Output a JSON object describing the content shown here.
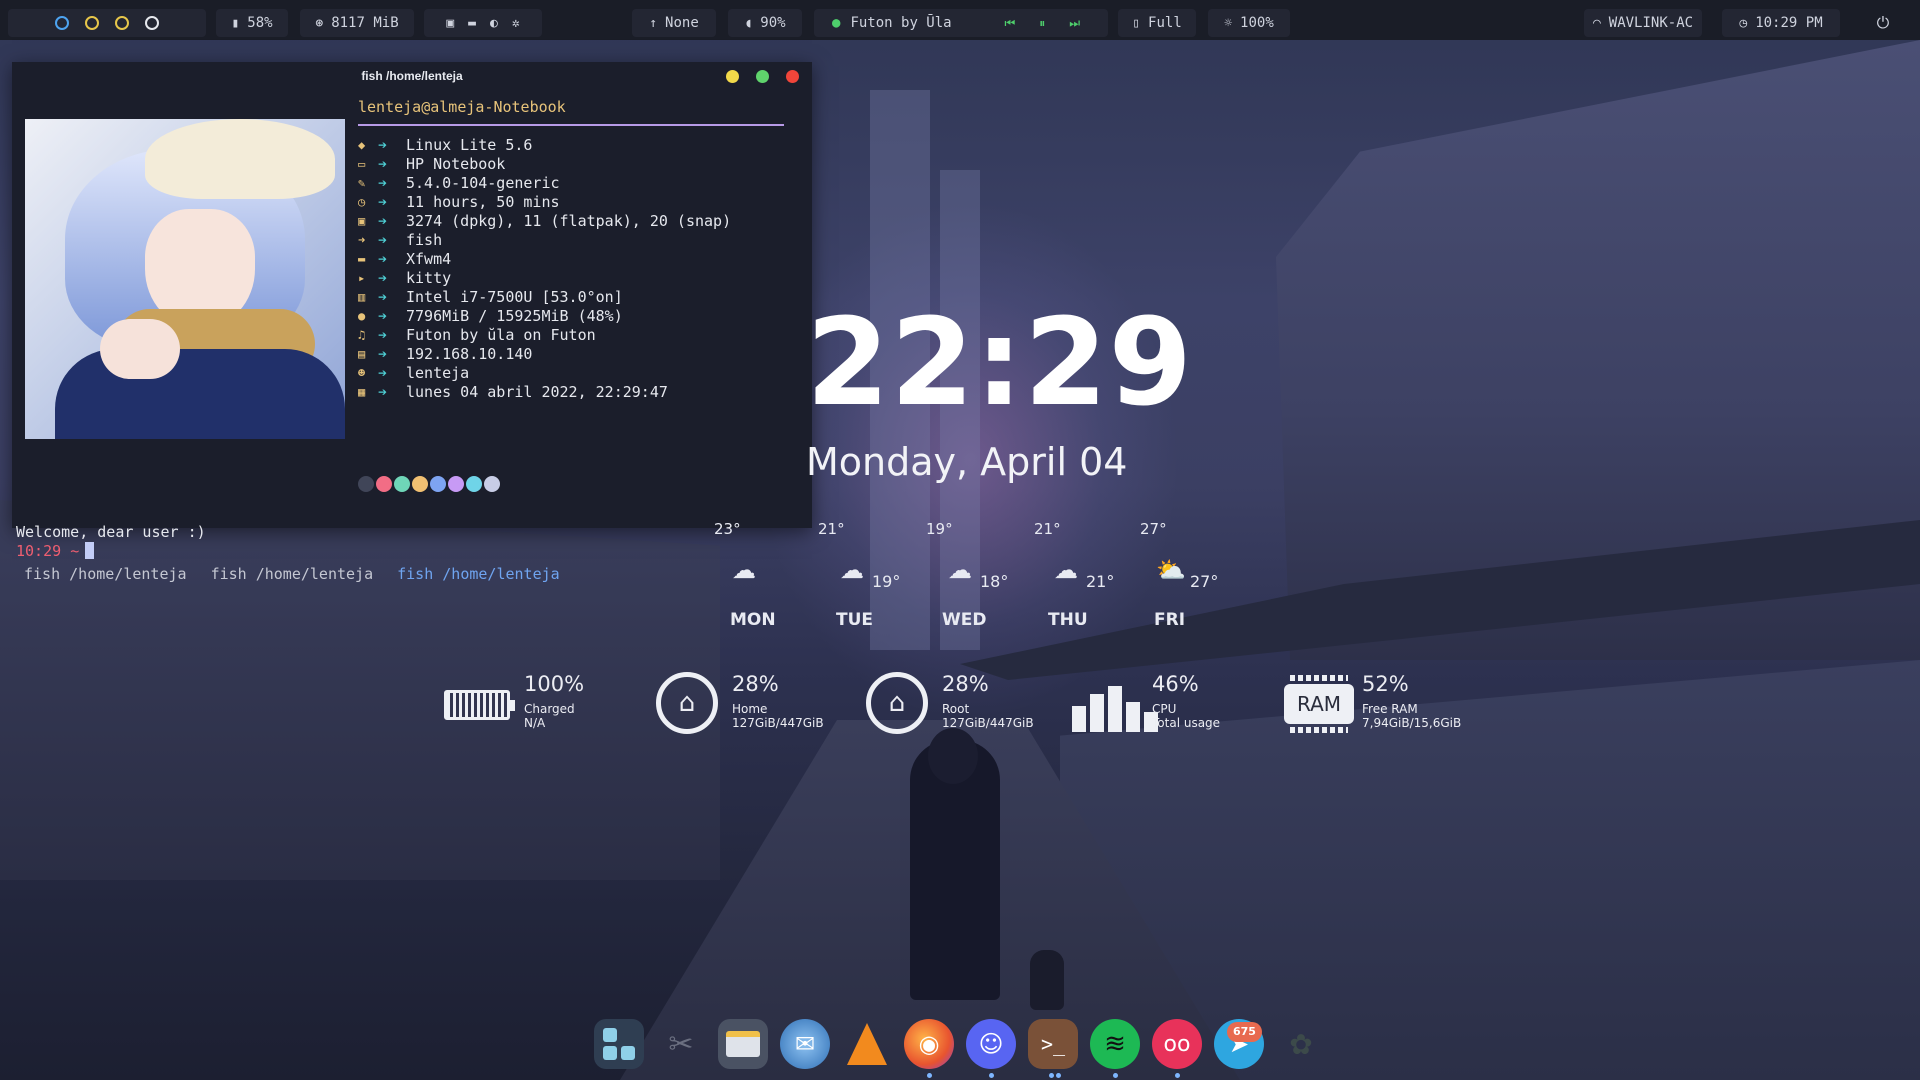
{
  "topbar": {
    "workspaces": [
      {
        "state": "active",
        "color": "#4da3f0"
      },
      {
        "state": "occupied",
        "color": "#e7c64a"
      },
      {
        "state": "occupied",
        "color": "#e7c64a"
      },
      {
        "state": "empty",
        "color": "#e6e8ee"
      }
    ],
    "disk_label": "58%",
    "memory_label": "8117 MiB",
    "network_up_label": "None",
    "volume_label": "90%",
    "now_playing": "Futon by Ūla",
    "battery_label": "Full",
    "brightness_label": "100%",
    "wifi_label": "WAVLINK-AC",
    "time_label": "10:29 PM"
  },
  "terminal": {
    "title": "fish /home/lenteja",
    "user": "lenteja",
    "at": "@",
    "host": "almeja-Notebook",
    "info": [
      {
        "icon": "os-icon",
        "value": "Linux Lite 5.6"
      },
      {
        "icon": "laptop-icon",
        "value": "HP Notebook"
      },
      {
        "icon": "wrench-icon",
        "value": "5.4.0-104-generic"
      },
      {
        "icon": "clock-icon",
        "value": "11 hours, 50 mins"
      },
      {
        "icon": "package-icon",
        "value": "3274 (dpkg), 11 (flatpak), 20 (snap)"
      },
      {
        "icon": "shell-icon",
        "value": "fish"
      },
      {
        "icon": "window-icon",
        "value": "Xfwm4"
      },
      {
        "icon": "terminal-icon",
        "value": "kitty"
      },
      {
        "icon": "cpu-icon",
        "value": "Intel i7-7500U [53.0°on]"
      },
      {
        "icon": "memory-icon",
        "value": "7796MiB / 15925MiB (48%)"
      },
      {
        "icon": "music-icon",
        "value": "Futon by ŭla on Futon"
      },
      {
        "icon": "network-icon",
        "value": "192.168.10.140"
      },
      {
        "icon": "user-icon",
        "value": "lenteja"
      },
      {
        "icon": "calendar-icon",
        "value": "lunes 04 abril 2022, 22:29:47"
      }
    ],
    "palette": [
      "#404558",
      "#f26d85",
      "#6fd6b8",
      "#f1c072",
      "#7ea4f2",
      "#c79af5",
      "#6fd4e8",
      "#c8cde6"
    ],
    "welcome": "Welcome, dear user :)",
    "prompt_time": "10:29",
    "prompt_symbol": "~",
    "tabs": [
      {
        "label": "fish /home/lenteja",
        "active": false
      },
      {
        "label": "fish /home/lenteja",
        "active": false
      },
      {
        "label": "fish /home/lenteja",
        "active": true
      }
    ]
  },
  "clock": {
    "time": "22:29",
    "date": "Monday, April 04"
  },
  "weather": [
    {
      "day": "MON",
      "high": "23°",
      "low": "",
      "icon": "rain-cloud-icon"
    },
    {
      "day": "TUE",
      "high": "21°",
      "low": "19°",
      "icon": "cloud-icon"
    },
    {
      "day": "WED",
      "high": "19°",
      "low": "18°",
      "icon": "cloud-icon"
    },
    {
      "day": "THU",
      "high": "21°",
      "low": "21°",
      "icon": "cloud-icon"
    },
    {
      "day": "FRI",
      "high": "27°",
      "low": "27°",
      "icon": "sun-cloud-icon"
    }
  ],
  "system": {
    "battery": {
      "value": "100%",
      "line1": "Charged",
      "line2": "N/A"
    },
    "home": {
      "value": "28%",
      "line1": "Home",
      "line2": "127GiB/447GiB"
    },
    "root": {
      "value": "28%",
      "line1": "Root",
      "line2": "127GiB/447GiB"
    },
    "cpu": {
      "value": "46%",
      "line1": "CPU",
      "line2": "Total usage"
    },
    "ram": {
      "chip": "RAM",
      "value": "52%",
      "line1": "Free RAM",
      "line2": "7,94GiB/15,6GiB"
    }
  },
  "dock": {
    "items": [
      {
        "name": "app-grid",
        "color": "#2f3e52"
      },
      {
        "name": "screenshot",
        "color": "transparent"
      },
      {
        "name": "files",
        "color": "#3a4150"
      },
      {
        "name": "mail",
        "color": "#3b6ea8"
      },
      {
        "name": "vlc",
        "color": "transparent"
      },
      {
        "name": "firefox",
        "color": "transparent"
      },
      {
        "name": "discord",
        "color": "#5865f2"
      },
      {
        "name": "terminal",
        "color": "#6b4a3a"
      },
      {
        "name": "spotify",
        "color": "#1db954"
      },
      {
        "name": "flickr-like",
        "color": "#e8325a"
      },
      {
        "name": "telegram",
        "color": "#2ea6e0"
      },
      {
        "name": "extra",
        "color": "transparent"
      }
    ],
    "telegram_badge": "675"
  }
}
